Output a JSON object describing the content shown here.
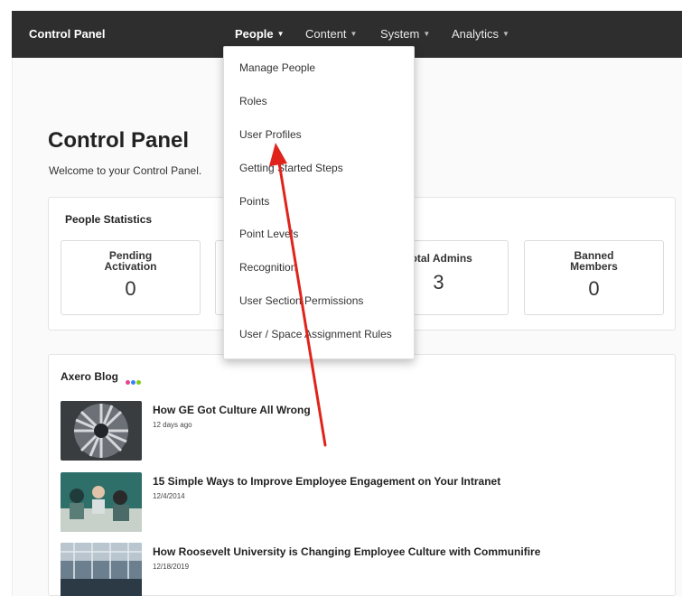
{
  "topbar": {
    "brand": "Control Panel",
    "nav": [
      {
        "label": "People"
      },
      {
        "label": "Content"
      },
      {
        "label": "System"
      },
      {
        "label": "Analytics"
      }
    ]
  },
  "page": {
    "title": "Control Panel",
    "subtitle": "Welcome to your Control Panel."
  },
  "people_statistics": {
    "title": "People Statistics",
    "cards": [
      {
        "label_line1": "Pending",
        "label_line2": "Activation",
        "value": "0"
      },
      {
        "label_line1": "",
        "label_line2": "",
        "value": ""
      },
      {
        "label_line1": "Total Admins",
        "label_line2": "",
        "value": "3"
      },
      {
        "label_line1": "Banned",
        "label_line2": "Members",
        "value": "0"
      }
    ]
  },
  "blog": {
    "title": "Axero Blog",
    "dot_colors": [
      "#e84393",
      "#3b82f6",
      "#84cc16"
    ],
    "posts": [
      {
        "title": "How GE Got Culture All Wrong",
        "date": "12 days ago"
      },
      {
        "title": "15 Simple Ways to Improve Employee Engagement on Your Intranet",
        "date": "12/4/2014"
      },
      {
        "title": "How Roosevelt University is Changing Employee Culture with Communifire",
        "date": "12/18/2019"
      }
    ]
  },
  "people_menu": {
    "items": [
      "Manage People",
      "Roles",
      "User Profiles",
      "Getting Started Steps",
      "Points",
      "Point Levels",
      "Recognition",
      "User Section Permissions",
      "User / Space Assignment Rules"
    ]
  },
  "colors": {
    "topbar": "#2e2e2e",
    "annotation_arrow": "#e0241b"
  }
}
